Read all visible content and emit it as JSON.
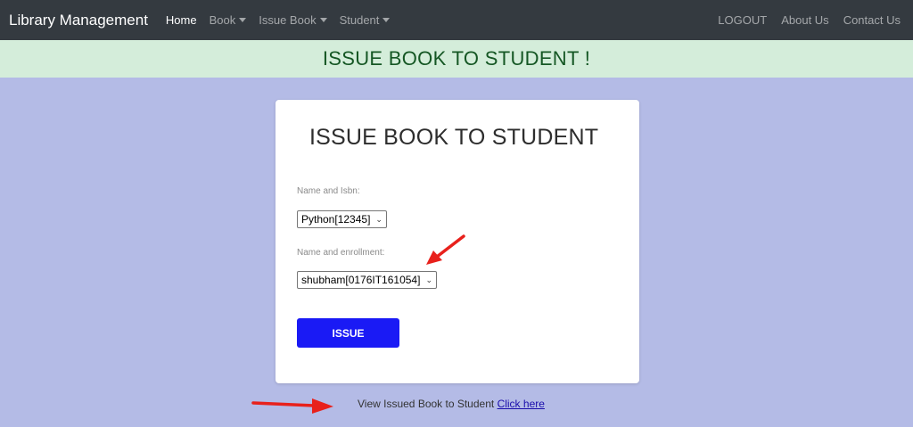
{
  "nav": {
    "brand": "Library Management",
    "items": [
      {
        "label": "Home",
        "active": true,
        "dropdown": false
      },
      {
        "label": "Book",
        "active": false,
        "dropdown": true
      },
      {
        "label": "Issue Book",
        "active": false,
        "dropdown": true
      },
      {
        "label": "Student",
        "active": false,
        "dropdown": true
      }
    ],
    "right_items": [
      {
        "label": "LOGOUT"
      },
      {
        "label": "About Us"
      },
      {
        "label": "Contact Us"
      }
    ]
  },
  "banner": {
    "text": "ISSUE BOOK TO STUDENT !",
    "bg": "#d4edda",
    "color": "#155724"
  },
  "form": {
    "title": "ISSUE BOOK TO STUDENT",
    "book_label": "Name and Isbn:",
    "book_value": "Python[12345]",
    "student_label": "Name and enrollment:",
    "student_value": "shubham[0176IT161054]",
    "submit_label": "ISSUE"
  },
  "footer": {
    "text": "View Issued Book to Student",
    "link": "Click here"
  },
  "colors": {
    "page_bg": "#b4bbe6",
    "navbar_bg": "#343a40",
    "button_bg": "#1a1af5",
    "annotation_arrow": "#e8211c"
  }
}
